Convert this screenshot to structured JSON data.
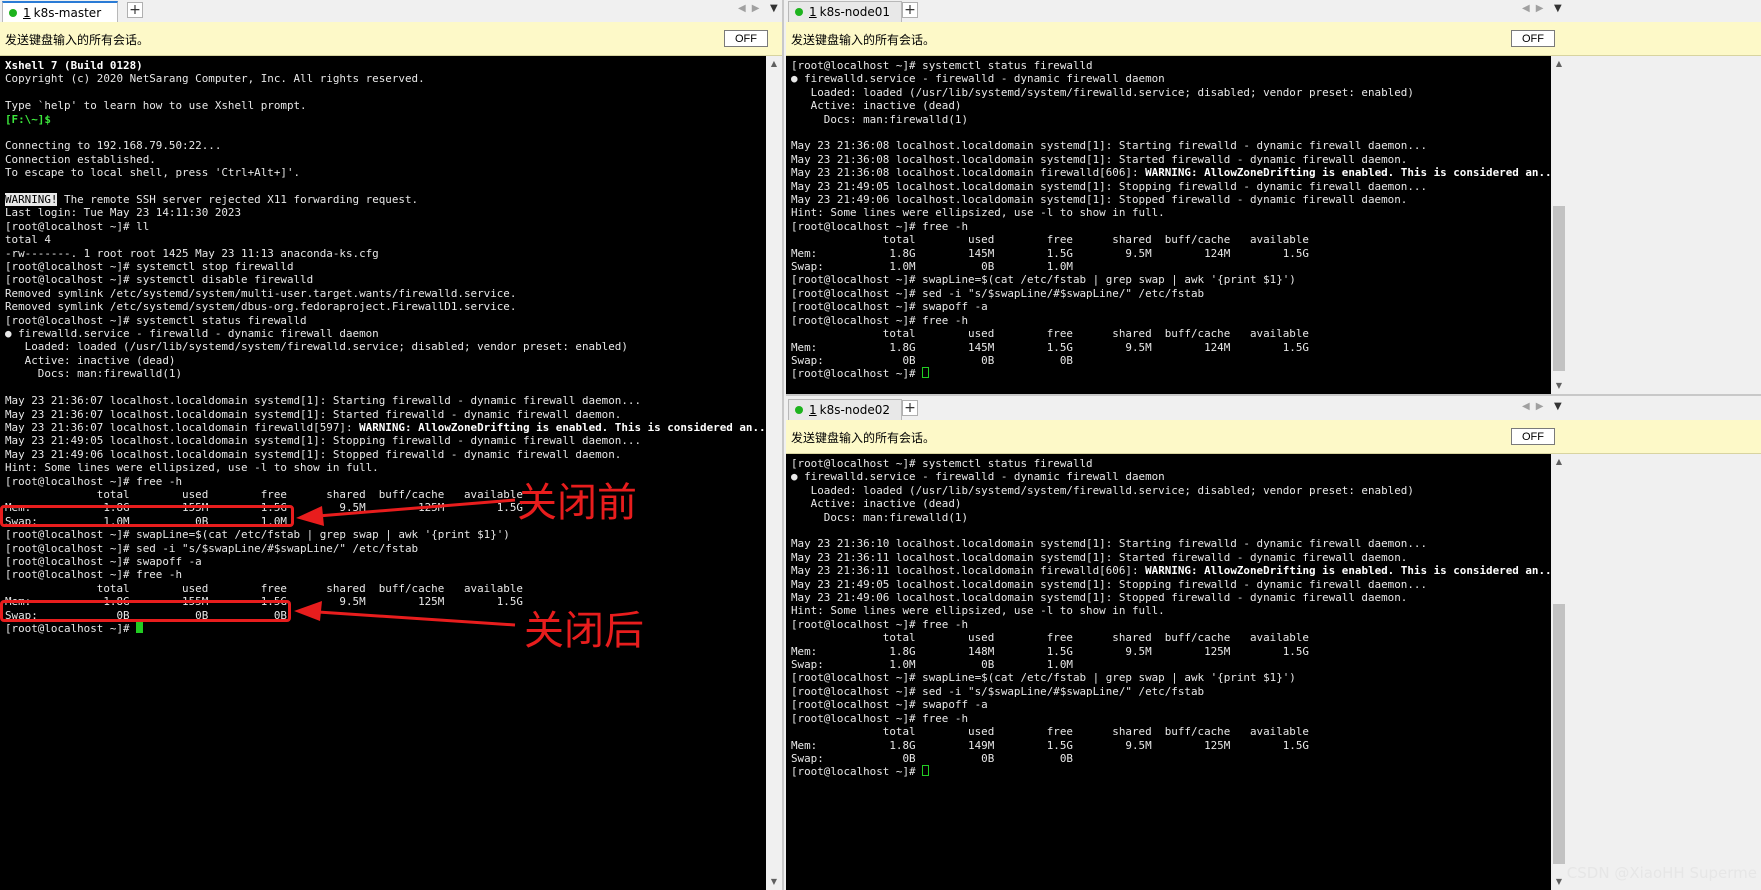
{
  "master": {
    "tab_number": "1",
    "tab_title": "k8s-master",
    "add_tab": "+",
    "broadcast_text": "发送键盘输入的所有会话。",
    "off_label": "OFF",
    "lines": [
      [
        {
          "t": "Xshell 7 (Build 0128)",
          "c": "bold"
        }
      ],
      [
        {
          "t": "Copyright (c) 2020 NetSarang Computer, Inc. All rights reserved."
        }
      ],
      [
        {
          "t": ""
        }
      ],
      [
        {
          "t": "Type `help' to learn how to use Xshell prompt."
        }
      ],
      [
        {
          "t": "[F:\\~]$",
          "c": "green"
        }
      ],
      [
        {
          "t": ""
        }
      ],
      [
        {
          "t": "Connecting to 192.168.79.50:22..."
        }
      ],
      [
        {
          "t": "Connection established."
        }
      ],
      [
        {
          "t": "To escape to local shell, press 'Ctrl+Alt+]'."
        }
      ],
      [
        {
          "t": ""
        }
      ],
      [
        {
          "t": "WARNING!",
          "c": "inv"
        },
        {
          "t": " The remote SSH server rejected X11 forwarding request."
        }
      ],
      [
        {
          "t": "Last login: Tue May 23 14:11:30 2023"
        }
      ],
      [
        {
          "t": "[root@localhost ~]# ll"
        }
      ],
      [
        {
          "t": "total 4"
        }
      ],
      [
        {
          "t": "-rw-------. 1 root root 1425 May 23 11:13 anaconda-ks.cfg"
        }
      ],
      [
        {
          "t": "[root@localhost ~]# systemctl stop firewalld"
        }
      ],
      [
        {
          "t": "[root@localhost ~]# systemctl disable firewalld"
        }
      ],
      [
        {
          "t": "Removed symlink /etc/systemd/system/multi-user.target.wants/firewalld.service."
        }
      ],
      [
        {
          "t": "Removed symlink /etc/systemd/system/dbus-org.fedoraproject.FirewallD1.service."
        }
      ],
      [
        {
          "t": "[root@localhost ~]# systemctl status firewalld"
        }
      ],
      [
        {
          "t": "● firewalld.service - firewalld - dynamic firewall daemon"
        }
      ],
      [
        {
          "t": "   Loaded: loaded (/usr/lib/systemd/system/firewalld.service; disabled; vendor preset: enabled)"
        }
      ],
      [
        {
          "t": "   Active: inactive (dead)"
        }
      ],
      [
        {
          "t": "     Docs: man:firewalld(1)"
        }
      ],
      [
        {
          "t": ""
        }
      ],
      [
        {
          "t": "May 23 21:36:07 localhost.localdomain systemd[1]: Starting firewalld - dynamic firewall daemon..."
        }
      ],
      [
        {
          "t": "May 23 21:36:07 localhost.localdomain systemd[1]: Started firewalld - dynamic firewall daemon."
        }
      ],
      [
        {
          "t": "May 23 21:36:07 localhost.localdomain firewalld[597]: "
        },
        {
          "t": "WARNING: AllowZoneDrifting is enabled. This is considered an...now.",
          "c": "bold"
        }
      ],
      [
        {
          "t": "May 23 21:49:05 localhost.localdomain systemd[1]: Stopping firewalld - dynamic firewall daemon..."
        }
      ],
      [
        {
          "t": "May 23 21:49:06 localhost.localdomain systemd[1]: Stopped firewalld - dynamic firewall daemon."
        }
      ],
      [
        {
          "t": "Hint: Some lines were ellipsized, use -l to show in full."
        }
      ],
      [
        {
          "t": "[root@localhost ~]# free -h"
        }
      ],
      [
        {
          "t": "              total        used        free      shared  buff/cache   available"
        }
      ],
      [
        {
          "t": "Mem:           1.8G        155M        1.5G        9.5M        125M        1.5G"
        }
      ],
      [
        {
          "t": "Swap:          1.0M          0B        1.0M"
        }
      ],
      [
        {
          "t": "[root@localhost ~]# swapLine=$(cat /etc/fstab | grep swap | awk '{print $1}')"
        }
      ],
      [
        {
          "t": "[root@localhost ~]# sed -i \"s/$swapLine/#$swapLine/\" /etc/fstab"
        }
      ],
      [
        {
          "t": "[root@localhost ~]# swapoff -a"
        }
      ],
      [
        {
          "t": "[root@localhost ~]# free -h"
        }
      ],
      [
        {
          "t": "              total        used        free      shared  buff/cache   available"
        }
      ],
      [
        {
          "t": "Mem:           1.8G        155M        1.5G        9.5M        125M        1.5G"
        }
      ],
      [
        {
          "t": "Swap:            0B          0B          0B"
        }
      ],
      [
        {
          "t": "[root@localhost ~]# "
        },
        {
          "t": "",
          "c": "cur"
        }
      ]
    ],
    "annotation_before": "关闭前",
    "annotation_after": "关闭后"
  },
  "node01": {
    "tab_number": "1",
    "tab_title": "k8s-node01",
    "add_tab": "+",
    "broadcast_text": "发送键盘输入的所有会话。",
    "off_label": "OFF",
    "lines": [
      [
        {
          "t": "[root@localhost ~]# systemctl status firewalld"
        }
      ],
      [
        {
          "t": "● firewalld.service - firewalld - dynamic firewall daemon"
        }
      ],
      [
        {
          "t": "   Loaded: loaded (/usr/lib/systemd/system/firewalld.service; disabled; vendor preset: enabled)"
        }
      ],
      [
        {
          "t": "   Active: inactive (dead)"
        }
      ],
      [
        {
          "t": "     Docs: man:firewalld(1)"
        }
      ],
      [
        {
          "t": ""
        }
      ],
      [
        {
          "t": "May 23 21:36:08 localhost.localdomain systemd[1]: Starting firewalld - dynamic firewall daemon..."
        }
      ],
      [
        {
          "t": "May 23 21:36:08 localhost.localdomain systemd[1]: Started firewalld - dynamic firewall daemon."
        }
      ],
      [
        {
          "t": "May 23 21:36:08 localhost.localdomain firewalld[606]: "
        },
        {
          "t": "WARNING: AllowZoneDrifting is enabled. This is considered an...now.",
          "c": "bold"
        }
      ],
      [
        {
          "t": "May 23 21:49:05 localhost.localdomain systemd[1]: Stopping firewalld - dynamic firewall daemon..."
        }
      ],
      [
        {
          "t": "May 23 21:49:06 localhost.localdomain systemd[1]: Stopped firewalld - dynamic firewall daemon."
        }
      ],
      [
        {
          "t": "Hint: Some lines were ellipsized, use -l to show in full."
        }
      ],
      [
        {
          "t": "[root@localhost ~]# free -h"
        }
      ],
      [
        {
          "t": "              total        used        free      shared  buff/cache   available"
        }
      ],
      [
        {
          "t": "Mem:           1.8G        145M        1.5G        9.5M        124M        1.5G"
        }
      ],
      [
        {
          "t": "Swap:          1.0M          0B        1.0M"
        }
      ],
      [
        {
          "t": "[root@localhost ~]# swapLine=$(cat /etc/fstab | grep swap | awk '{print $1}')"
        }
      ],
      [
        {
          "t": "[root@localhost ~]# sed -i \"s/$swapLine/#$swapLine/\" /etc/fstab"
        }
      ],
      [
        {
          "t": "[root@localhost ~]# swapoff -a"
        }
      ],
      [
        {
          "t": "[root@localhost ~]# free -h"
        }
      ],
      [
        {
          "t": "              total        used        free      shared  buff/cache   available"
        }
      ],
      [
        {
          "t": "Mem:           1.8G        145M        1.5G        9.5M        124M        1.5G"
        }
      ],
      [
        {
          "t": "Swap:            0B          0B          0B"
        }
      ],
      [
        {
          "t": "[root@localhost ~]# "
        },
        {
          "t": "",
          "c": "curbox"
        }
      ]
    ]
  },
  "node02": {
    "tab_number": "1",
    "tab_title": "k8s-node02",
    "add_tab": "+",
    "broadcast_text": "发送键盘输入的所有会话。",
    "off_label": "OFF",
    "lines": [
      [
        {
          "t": "[root@localhost ~]# systemctl status firewalld"
        }
      ],
      [
        {
          "t": "● firewalld.service - firewalld - dynamic firewall daemon"
        }
      ],
      [
        {
          "t": "   Loaded: loaded (/usr/lib/systemd/system/firewalld.service; disabled; vendor preset: enabled)"
        }
      ],
      [
        {
          "t": "   Active: inactive (dead)"
        }
      ],
      [
        {
          "t": "     Docs: man:firewalld(1)"
        }
      ],
      [
        {
          "t": ""
        }
      ],
      [
        {
          "t": "May 23 21:36:10 localhost.localdomain systemd[1]: Starting firewalld - dynamic firewall daemon..."
        }
      ],
      [
        {
          "t": "May 23 21:36:11 localhost.localdomain systemd[1]: Started firewalld - dynamic firewall daemon."
        }
      ],
      [
        {
          "t": "May 23 21:36:11 localhost.localdomain firewalld[606]: "
        },
        {
          "t": "WARNING: AllowZoneDrifting is enabled. This is considered an...now.",
          "c": "bold"
        }
      ],
      [
        {
          "t": "May 23 21:49:05 localhost.localdomain systemd[1]: Stopping firewalld - dynamic firewall daemon..."
        }
      ],
      [
        {
          "t": "May 23 21:49:06 localhost.localdomain systemd[1]: Stopped firewalld - dynamic firewall daemon."
        }
      ],
      [
        {
          "t": "Hint: Some lines were ellipsized, use -l to show in full."
        }
      ],
      [
        {
          "t": "[root@localhost ~]# free -h"
        }
      ],
      [
        {
          "t": "              total        used        free      shared  buff/cache   available"
        }
      ],
      [
        {
          "t": "Mem:           1.8G        148M        1.5G        9.5M        125M        1.5G"
        }
      ],
      [
        {
          "t": "Swap:          1.0M          0B        1.0M"
        }
      ],
      [
        {
          "t": "[root@localhost ~]# swapLine=$(cat /etc/fstab | grep swap | awk '{print $1}')"
        }
      ],
      [
        {
          "t": "[root@localhost ~]# sed -i \"s/$swapLine/#$swapLine/\" /etc/fstab"
        }
      ],
      [
        {
          "t": "[root@localhost ~]# swapoff -a"
        }
      ],
      [
        {
          "t": "[root@localhost ~]# free -h"
        }
      ],
      [
        {
          "t": "              total        used        free      shared  buff/cache   available"
        }
      ],
      [
        {
          "t": "Mem:           1.8G        149M        1.5G        9.5M        125M        1.5G"
        }
      ],
      [
        {
          "t": "Swap:            0B          0B          0B"
        }
      ],
      [
        {
          "t": "[root@localhost ~]# "
        },
        {
          "t": "",
          "c": "curbox"
        }
      ]
    ]
  },
  "watermark": "CSDN @XiaoHH Superme",
  "colors": {
    "terminal_bg": "#000000",
    "annotation": "#e81d1d",
    "broadcast_bg": "#fdf9c8",
    "active_dot": "#1db31d"
  }
}
